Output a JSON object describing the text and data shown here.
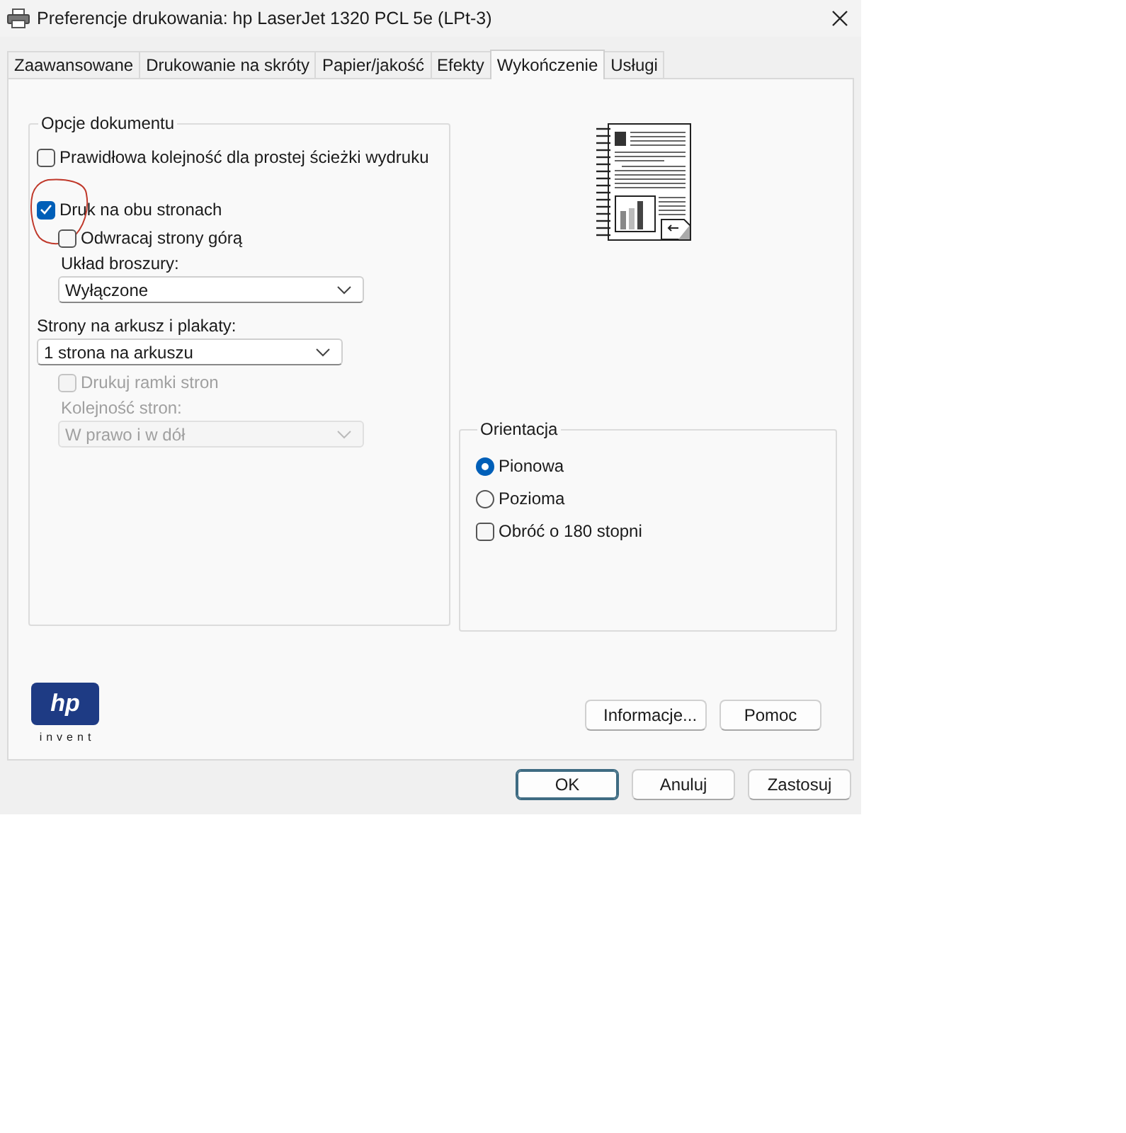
{
  "window": {
    "title": "Preferencje drukowania: hp LaserJet 1320 PCL 5e (LPt-3)"
  },
  "tabs": [
    {
      "label": "Zaawansowane",
      "selected": false
    },
    {
      "label": "Drukowanie na skróty",
      "selected": false
    },
    {
      "label": "Papier/jakość",
      "selected": false
    },
    {
      "label": "Efekty",
      "selected": false
    },
    {
      "label": "Wykończenie",
      "selected": true
    },
    {
      "label": "Usługi",
      "selected": false
    }
  ],
  "document_options": {
    "title": "Opcje dokumentu",
    "items": [
      {
        "kind": "checkbox",
        "label": "Prawidłowa kolejność dla prostej ścieżki wydruku",
        "checked": false,
        "disabled": false,
        "circled": false
      },
      {
        "kind": "checkbox",
        "label": "Druk na obu stronach",
        "checked": true,
        "disabled": false,
        "circled": true,
        "children": [
          {
            "kind": "checkbox",
            "label": "Odwracaj strony górą",
            "checked": false,
            "disabled": false,
            "circled": false
          },
          {
            "kind": "label",
            "label": "Układ broszury:",
            "disabled": false
          },
          {
            "kind": "dropdown",
            "value": "Wyłączone",
            "disabled": false
          }
        ]
      },
      {
        "kind": "label",
        "label": "Strony na arkusz i plakaty:",
        "disabled": false
      },
      {
        "kind": "dropdown",
        "value": "1 strona na arkuszu",
        "disabled": false,
        "children": [
          {
            "kind": "checkbox",
            "label": "Drukuj ramki stron",
            "checked": false,
            "disabled": true,
            "circled": false
          },
          {
            "kind": "label",
            "label": "Kolejność stron:",
            "disabled": true
          },
          {
            "kind": "dropdown",
            "value": "W prawo i w dół",
            "disabled": true
          }
        ]
      }
    ]
  },
  "orientation": {
    "title": "Orientacja",
    "items": [
      {
        "kind": "radio",
        "label": "Pionowa",
        "selected": true
      },
      {
        "kind": "radio",
        "label": "Pozioma",
        "selected": false
      },
      {
        "kind": "checkbox",
        "label": "Obróć o 180 stopni",
        "checked": false
      }
    ]
  },
  "logo": {
    "mark": "hp",
    "tagline": "invent"
  },
  "panel_buttons": [
    "Informacje...",
    "Pomoc"
  ],
  "dialog_buttons": [
    {
      "label": "OK",
      "default": true
    },
    {
      "label": "Anuluj",
      "default": false
    },
    {
      "label": "Zastosuj",
      "default": false
    }
  ]
}
